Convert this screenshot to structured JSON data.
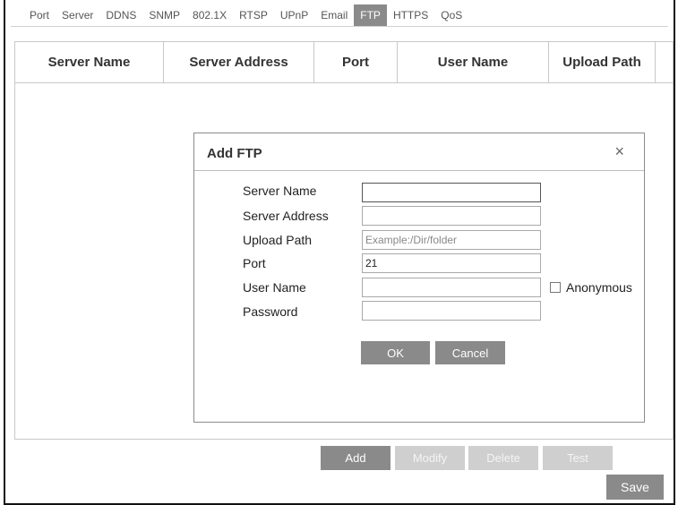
{
  "tabs": [
    {
      "label": "Port",
      "active": false
    },
    {
      "label": "Server",
      "active": false
    },
    {
      "label": "DDNS",
      "active": false
    },
    {
      "label": "SNMP",
      "active": false
    },
    {
      "label": "802.1X",
      "active": false
    },
    {
      "label": "RTSP",
      "active": false
    },
    {
      "label": "UPnP",
      "active": false
    },
    {
      "label": "Email",
      "active": false
    },
    {
      "label": "FTP",
      "active": true
    },
    {
      "label": "HTTPS",
      "active": false
    },
    {
      "label": "QoS",
      "active": false
    }
  ],
  "table": {
    "columns": [
      "Server Name",
      "Server Address",
      "Port",
      "User Name",
      "Upload Path"
    ],
    "rows": []
  },
  "dialog": {
    "title": "Add FTP",
    "close_glyph": "×",
    "fields": {
      "server_name": {
        "label": "Server Name",
        "value": "",
        "placeholder": ""
      },
      "server_address": {
        "label": "Server Address",
        "value": "",
        "placeholder": ""
      },
      "upload_path": {
        "label": "Upload Path",
        "value": "",
        "placeholder": "Example:/Dir/folder"
      },
      "port": {
        "label": "Port",
        "value": "21",
        "placeholder": ""
      },
      "user_name": {
        "label": "User Name",
        "value": "",
        "placeholder": ""
      },
      "password": {
        "label": "Password",
        "value": "",
        "placeholder": ""
      }
    },
    "anonymous_label": "Anonymous",
    "anonymous_checked": false,
    "ok_label": "OK",
    "cancel_label": "Cancel"
  },
  "actions": {
    "add": "Add",
    "modify": "Modify",
    "delete": "Delete",
    "test": "Test",
    "save": "Save"
  }
}
